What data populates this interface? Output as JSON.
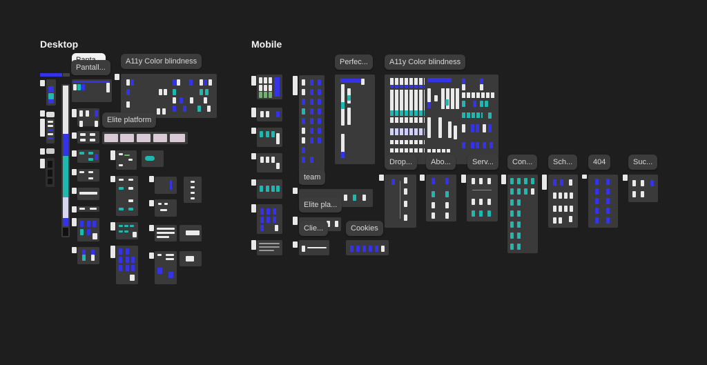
{
  "sections": {
    "desktop": {
      "title": "Desktop"
    },
    "mobile": {
      "title": "Mobile"
    }
  },
  "desktop_labels": {
    "panta_tab": "Panta",
    "pantall": "Pantall...",
    "a11y": "A11y Color blindness",
    "elite_platform": "Elite platform"
  },
  "mobile_labels": {
    "perfec": "Perfec...",
    "a11y": "A11y Color blindness",
    "drop": "Drop...",
    "abo": "Abo...",
    "serv": "Serv...",
    "con": "Con...",
    "sch": "Sch...",
    "404": "404",
    "suc": "Suc...",
    "team": "team",
    "elite_pla": "Elite pla...",
    "clie": "Clie...",
    "cookies": "Cookies"
  },
  "colors": {
    "canvas": "#1e1e1e",
    "frame": "#3a3a3a",
    "accent_blue": "#3434e6",
    "accent_teal": "#1fb8b0"
  }
}
